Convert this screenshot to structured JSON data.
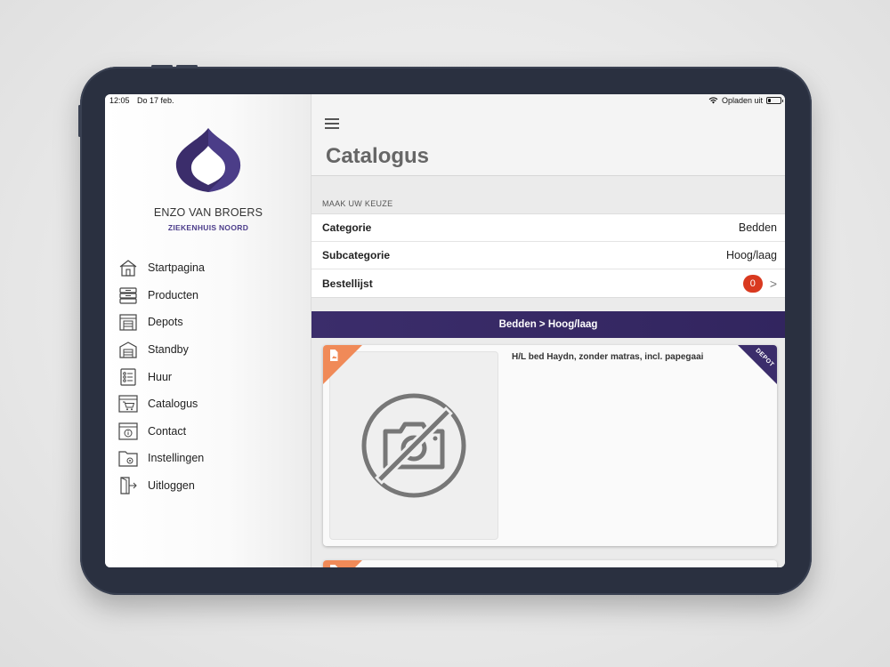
{
  "status_bar": {
    "time": "12:05",
    "date": "Do 17 feb.",
    "charging": "Opladen uit"
  },
  "sidebar": {
    "user_name": "ENZO VAN BROERS",
    "organization": "ZIEKENHUIS NOORD",
    "items": [
      {
        "label": "Startpagina",
        "icon": "home-icon"
      },
      {
        "label": "Producten",
        "icon": "boxes-icon"
      },
      {
        "label": "Depots",
        "icon": "warehouse-icon"
      },
      {
        "label": "Standby",
        "icon": "standby-warehouse-icon"
      },
      {
        "label": "Huur",
        "icon": "checklist-icon"
      },
      {
        "label": "Catalogus",
        "icon": "cart-icon"
      },
      {
        "label": "Contact",
        "icon": "contact-icon"
      },
      {
        "label": "Instellingen",
        "icon": "settings-folder-icon"
      },
      {
        "label": "Uitloggen",
        "icon": "logout-icon"
      }
    ]
  },
  "main": {
    "title": "Catalogus",
    "section_caption": "MAAK UW KEUZE",
    "rows": {
      "category_label": "Categorie",
      "category_value": "Bedden",
      "subcategory_label": "Subcategorie",
      "subcategory_value": "Hoog/laag",
      "orderlist_label": "Bestellijst",
      "orderlist_count": "0",
      "chevron": ">"
    },
    "category_path": "Bedden > Hoog/laag",
    "products": [
      {
        "name": "H/L bed Haydn, zonder matras, incl. papegaai",
        "tag": "DEPOT",
        "image": "no-photo-icon"
      }
    ]
  },
  "colors": {
    "brand_purple": "#3b2d6b",
    "accent_orange": "#f08a58",
    "badge_red": "#d9391f"
  }
}
